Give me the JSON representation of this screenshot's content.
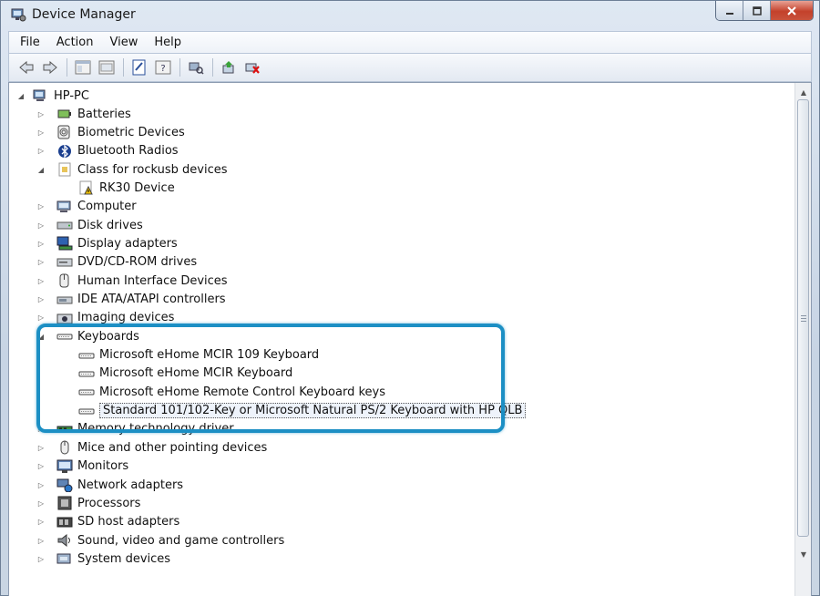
{
  "window": {
    "title": "Device Manager",
    "icon": "device-manager-icon",
    "caption_buttons": [
      "minimize",
      "maximize",
      "close"
    ]
  },
  "menu": [
    "File",
    "Action",
    "View",
    "Help"
  ],
  "toolbar": [
    {
      "name": "back-icon"
    },
    {
      "name": "forward-icon"
    },
    {
      "name": "show-hide-console-tree-icon"
    },
    {
      "name": "up-one-level-icon"
    },
    {
      "name": "properties-icon"
    },
    {
      "name": "help-icon"
    },
    {
      "name": "scan-hardware-changes-icon"
    },
    {
      "name": "update-driver-icon"
    },
    {
      "name": "uninstall-icon"
    }
  ],
  "tree": {
    "root": "HP-PC",
    "items": [
      {
        "label": "Batteries",
        "expander": "▷",
        "icon": "battery-icon"
      },
      {
        "label": "Biometric Devices",
        "expander": "▷",
        "icon": "fingerprint-icon"
      },
      {
        "label": "Bluetooth Radios",
        "expander": "▷",
        "icon": "bluetooth-icon"
      },
      {
        "label": "Class for rockusb devices",
        "expander": "◢",
        "icon": "device-class-icon"
      },
      {
        "label": "RK30 Device",
        "expander": "",
        "icon": "warning-device-icon",
        "child": true
      },
      {
        "label": "Computer",
        "expander": "▷",
        "icon": "computer-icon"
      },
      {
        "label": "Disk drives",
        "expander": "▷",
        "icon": "disk-drive-icon"
      },
      {
        "label": "Display adapters",
        "expander": "▷",
        "icon": "display-adapter-icon"
      },
      {
        "label": "DVD/CD-ROM drives",
        "expander": "▷",
        "icon": "dvd-drive-icon"
      },
      {
        "label": "Human Interface Devices",
        "expander": "▷",
        "icon": "hid-icon"
      },
      {
        "label": "IDE ATA/ATAPI controllers",
        "expander": "▷",
        "icon": "ide-controller-icon"
      },
      {
        "label": "Imaging devices",
        "expander": "▷",
        "icon": "camera-icon"
      },
      {
        "label": "Keyboards",
        "expander": "◢",
        "icon": "keyboard-icon"
      },
      {
        "label": "Microsoft eHome MCIR 109 Keyboard",
        "expander": "",
        "icon": "keyboard-icon",
        "child": true
      },
      {
        "label": "Microsoft eHome MCIR Keyboard",
        "expander": "",
        "icon": "keyboard-icon",
        "child": true
      },
      {
        "label": "Microsoft eHome Remote Control Keyboard keys",
        "expander": "",
        "icon": "keyboard-icon",
        "child": true
      },
      {
        "label": "Standard 101/102-Key or Microsoft Natural PS/2 Keyboard with HP QLB",
        "expander": "",
        "icon": "keyboard-icon",
        "child": true,
        "selected": true
      },
      {
        "label": "Memory technology driver",
        "expander": "▷",
        "icon": "memory-icon"
      },
      {
        "label": "Mice and other pointing devices",
        "expander": "▷",
        "icon": "mouse-icon"
      },
      {
        "label": "Monitors",
        "expander": "▷",
        "icon": "monitor-icon"
      },
      {
        "label": "Network adapters",
        "expander": "▷",
        "icon": "network-adapter-icon"
      },
      {
        "label": "Processors",
        "expander": "▷",
        "icon": "processor-icon"
      },
      {
        "label": "SD host adapters",
        "expander": "▷",
        "icon": "sd-card-icon"
      },
      {
        "label": "Sound, video and game controllers",
        "expander": "▷",
        "icon": "speaker-icon"
      },
      {
        "label": "System devices",
        "expander": "▷",
        "icon": "system-device-icon"
      }
    ]
  },
  "highlight_color": "#1c8fc4"
}
